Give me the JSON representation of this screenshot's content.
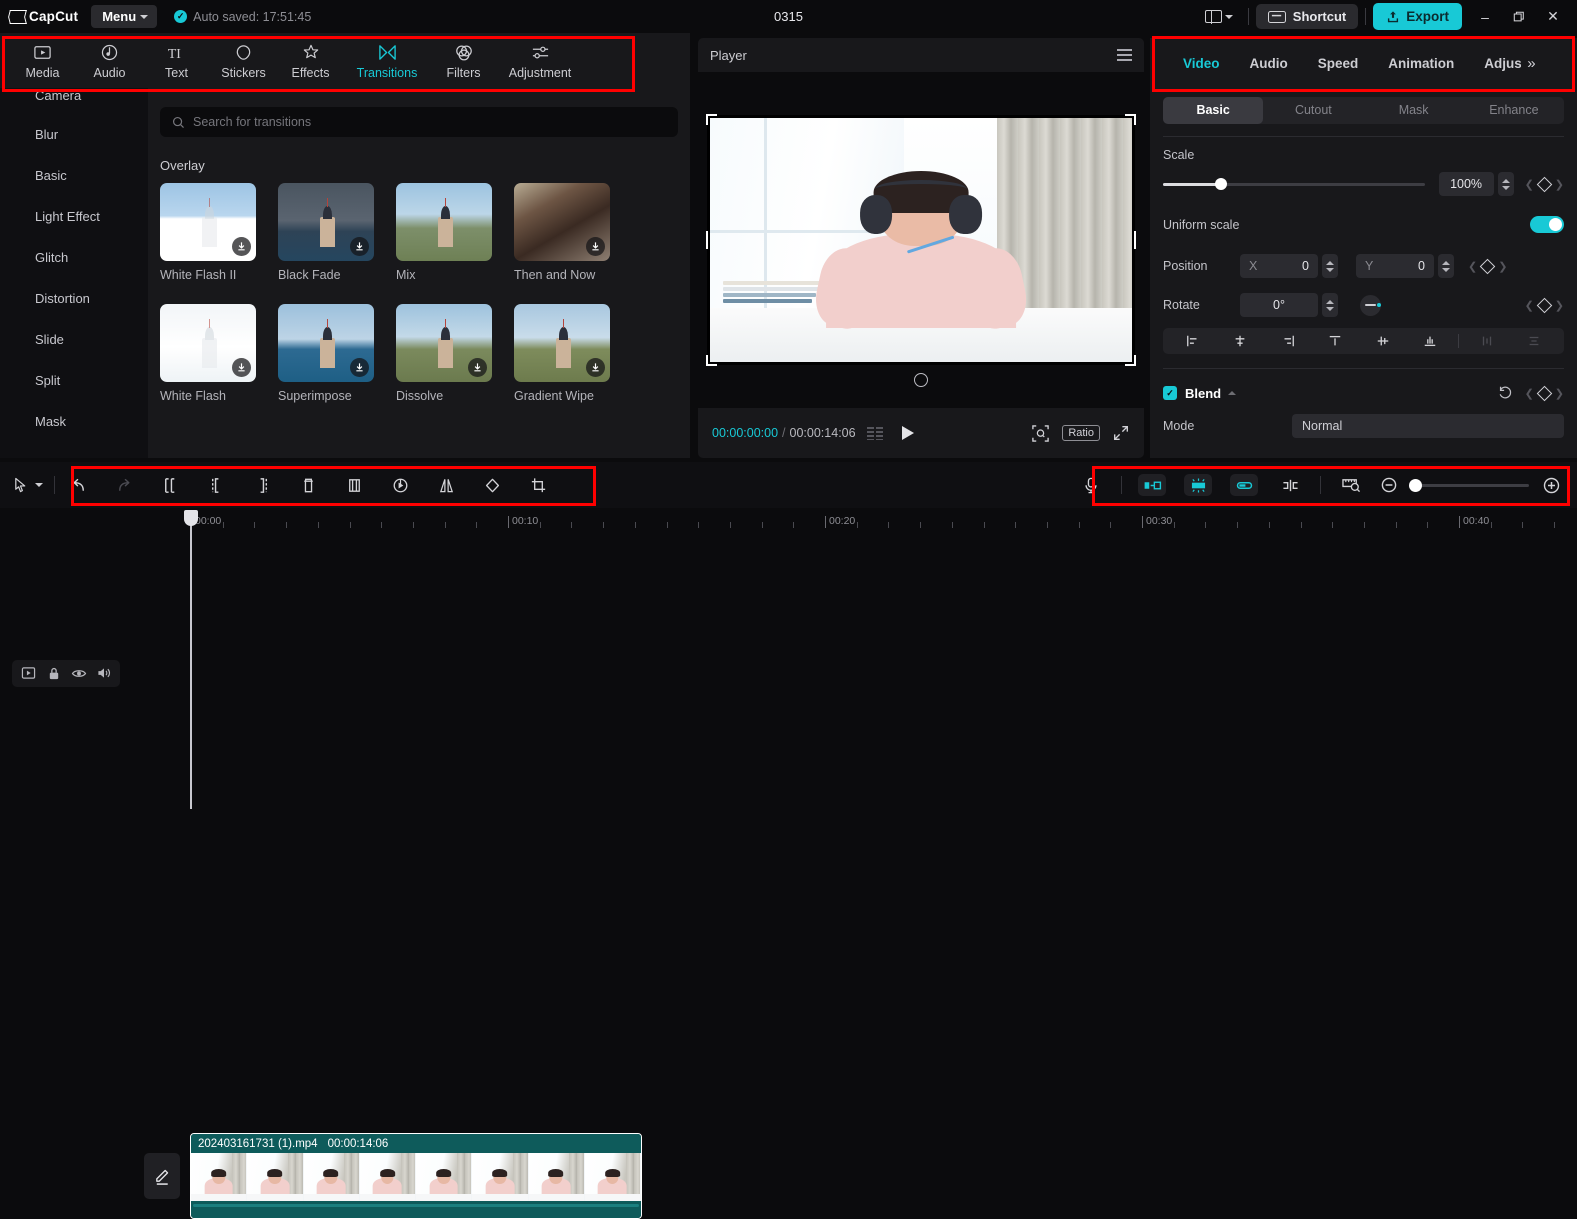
{
  "app": {
    "brand": "CapCut",
    "menu_label": "Menu",
    "autosave_text": "Auto saved: 17:51:45",
    "project_title": "0315",
    "shortcut_label": "Shortcut",
    "export_label": "Export",
    "window_controls": {
      "minimize": "–",
      "maximize": "❐",
      "close": "✕"
    }
  },
  "media_tabs": [
    {
      "label": "Media",
      "icon": "media-icon",
      "active": false
    },
    {
      "label": "Audio",
      "icon": "audio-icon",
      "active": false
    },
    {
      "label": "Text",
      "icon": "text-icon",
      "active": false
    },
    {
      "label": "Stickers",
      "icon": "stickers-icon",
      "active": false
    },
    {
      "label": "Effects",
      "icon": "effects-icon",
      "active": false
    },
    {
      "label": "Transitions",
      "icon": "transitions-icon",
      "active": true
    },
    {
      "label": "Filters",
      "icon": "filters-icon",
      "active": false
    },
    {
      "label": "Adjustment",
      "icon": "adjustment-icon",
      "active": false
    }
  ],
  "categories": [
    {
      "label": "Camera"
    },
    {
      "label": "Blur"
    },
    {
      "label": "Basic"
    },
    {
      "label": "Light Effect"
    },
    {
      "label": "Glitch"
    },
    {
      "label": "Distortion"
    },
    {
      "label": "Slide"
    },
    {
      "label": "Split"
    },
    {
      "label": "Mask"
    }
  ],
  "transitions": {
    "search_placeholder": "Search for transitions",
    "section_title": "Overlay",
    "items": [
      {
        "label": "White Flash II",
        "art": "art-whiteflash2",
        "download": true
      },
      {
        "label": "Black Fade",
        "art": "art-tower-dark",
        "download": true
      },
      {
        "label": "Mix",
        "art": "art-tower-mix",
        "download": false
      },
      {
        "label": "Then and Now",
        "art": "art-portrait",
        "download": true
      },
      {
        "label": "White Flash",
        "art": "art-whiteflash",
        "download": true
      },
      {
        "label": "Superimpose",
        "art": "art-superimpose",
        "download": true
      },
      {
        "label": "Dissolve",
        "art": "art-dissolve",
        "download": true
      },
      {
        "label": "Gradient Wipe",
        "art": "art-gradwipe",
        "download": true
      }
    ]
  },
  "player": {
    "title": "Player",
    "current_time": "00:00:00:00",
    "separator": "/",
    "total_time": "00:00:14:06",
    "ratio_label": "Ratio"
  },
  "properties": {
    "tabs": [
      {
        "label": "Video",
        "active": true
      },
      {
        "label": "Audio",
        "active": false
      },
      {
        "label": "Speed",
        "active": false
      },
      {
        "label": "Animation",
        "active": false
      },
      {
        "label": "Adjust",
        "active": false
      }
    ],
    "more_chevron": "»",
    "sub_tabs": [
      {
        "label": "Basic",
        "active": true
      },
      {
        "label": "Cutout",
        "active": false
      },
      {
        "label": "Mask",
        "active": false
      },
      {
        "label": "Enhance",
        "active": false
      }
    ],
    "scale_label": "Scale",
    "scale_value": "100%",
    "scale_percent": 22,
    "uniform_scale_label": "Uniform scale",
    "uniform_scale_on": true,
    "position_label": "Position",
    "position_x_axis": "X",
    "position_x_value": "0",
    "position_y_axis": "Y",
    "position_y_value": "0",
    "rotate_label": "Rotate",
    "rotate_value": "0°",
    "blend_label": "Blend",
    "blend_enabled": true,
    "mode_label": "Mode",
    "mode_value": "Normal"
  },
  "timeline_toolbar": {
    "left_tools": [
      {
        "name": "undo-button",
        "enabled": true
      },
      {
        "name": "redo-button",
        "enabled": false
      },
      {
        "name": "split-button",
        "enabled": true
      },
      {
        "name": "trim-left-button",
        "enabled": true
      },
      {
        "name": "trim-right-button",
        "enabled": true
      },
      {
        "name": "delete-button",
        "enabled": true
      },
      {
        "name": "freeze-button",
        "enabled": true
      },
      {
        "name": "reverse-button",
        "enabled": true
      },
      {
        "name": "mirror-button",
        "enabled": true
      },
      {
        "name": "rotate-button",
        "enabled": true
      },
      {
        "name": "crop-button",
        "enabled": true
      }
    ],
    "right_tools": [
      {
        "name": "record-voiceover-button"
      },
      {
        "name": "auto-caption-button"
      },
      {
        "name": "auto-cutout-button"
      },
      {
        "name": "link-clip-button"
      },
      {
        "name": "split-marker-button"
      },
      {
        "name": "timeline-fit-button"
      },
      {
        "name": "zoom-out-button"
      },
      {
        "name": "zoom-slider"
      },
      {
        "name": "zoom-in-button"
      }
    ]
  },
  "timeline": {
    "ruler_labels": [
      "00:00",
      "00:10",
      "00:20",
      "00:30",
      "00:40"
    ],
    "track_buttons": [
      "track-type-icon",
      "lock-icon",
      "eye-icon",
      "speaker-icon"
    ],
    "clip": {
      "name": "202403161731 (1).mp4",
      "duration": "00:00:14:06",
      "thumb_count": 8
    }
  },
  "colors": {
    "accent": "#18c9d6",
    "clip": "#0e5b5b",
    "annotation": "#ff0000",
    "panel": "#18181b",
    "background": "#0b0b0d"
  }
}
